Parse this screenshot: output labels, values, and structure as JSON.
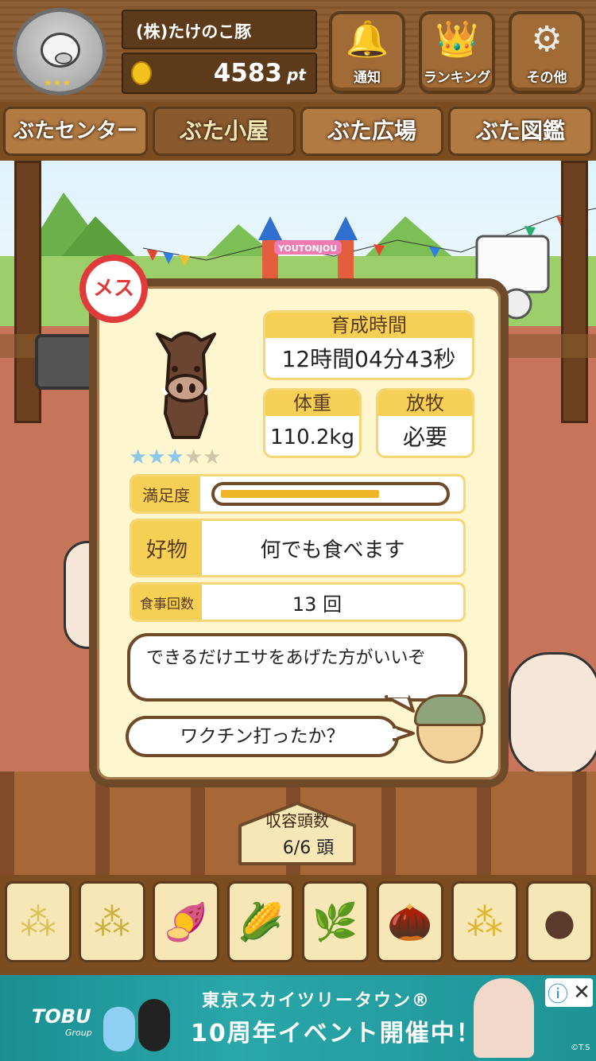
{
  "header": {
    "company_name": "(株)たけのこ豚",
    "points_value": "4583",
    "points_unit": "pt",
    "buttons": [
      {
        "label": "通知",
        "icon": "bell-icon"
      },
      {
        "label": "ランキング",
        "icon": "crown-icon"
      },
      {
        "label": "その他",
        "icon": "gear-icon"
      }
    ]
  },
  "tabs": [
    {
      "label": "ぶたセンター"
    },
    {
      "label": "ぶた小屋",
      "active": true
    },
    {
      "label": "ぶた広場"
    },
    {
      "label": "ぶた図鑑"
    }
  ],
  "scene": {
    "gate_sign": "YOUTONJOU"
  },
  "pig": {
    "gender_label": "メス",
    "rating": 3,
    "rating_max": 5,
    "raise_time_label": "育成時間",
    "raise_time_value": "12時間04分43秒",
    "weight_label": "体重",
    "weight_value": "110.2kg",
    "grazing_label": "放牧",
    "grazing_value": "必要",
    "satisfaction_label": "満足度",
    "satisfaction_fraction": 0.72,
    "favorite_label": "好物",
    "favorite_value": "何でも食べます",
    "meals_label": "食事回数",
    "meals_value": "13 回",
    "advice": "できるだけエサをあげた方がいいぞ",
    "question": "ワクチン打ったか？"
  },
  "capacity": {
    "label": "収容頭数",
    "value": "6/6 頭"
  },
  "food_items": [
    {
      "icon": "grain-pile-icon"
    },
    {
      "icon": "bean-pile-icon"
    },
    {
      "icon": "sweet-potato-icon"
    },
    {
      "icon": "corn-icon"
    },
    {
      "icon": "leafy-beans-icon"
    },
    {
      "icon": "acorn-icon"
    },
    {
      "icon": "grain-bowl-icon"
    },
    {
      "icon": "dark-balls-plate-icon"
    }
  ],
  "ad": {
    "logo": "TOBU",
    "logo_sub": "Group",
    "line1": "東京スカイツリータウン®",
    "line2": "10周年イベント開催中！",
    "credit": "©T.S"
  },
  "colors": {
    "wood_dark": "#5c3b1a",
    "panel_bg": "#fef6cf",
    "label_yellow": "#f6cf55",
    "female_red": "#e03a3a",
    "star_blue": "#8cc6e8"
  }
}
